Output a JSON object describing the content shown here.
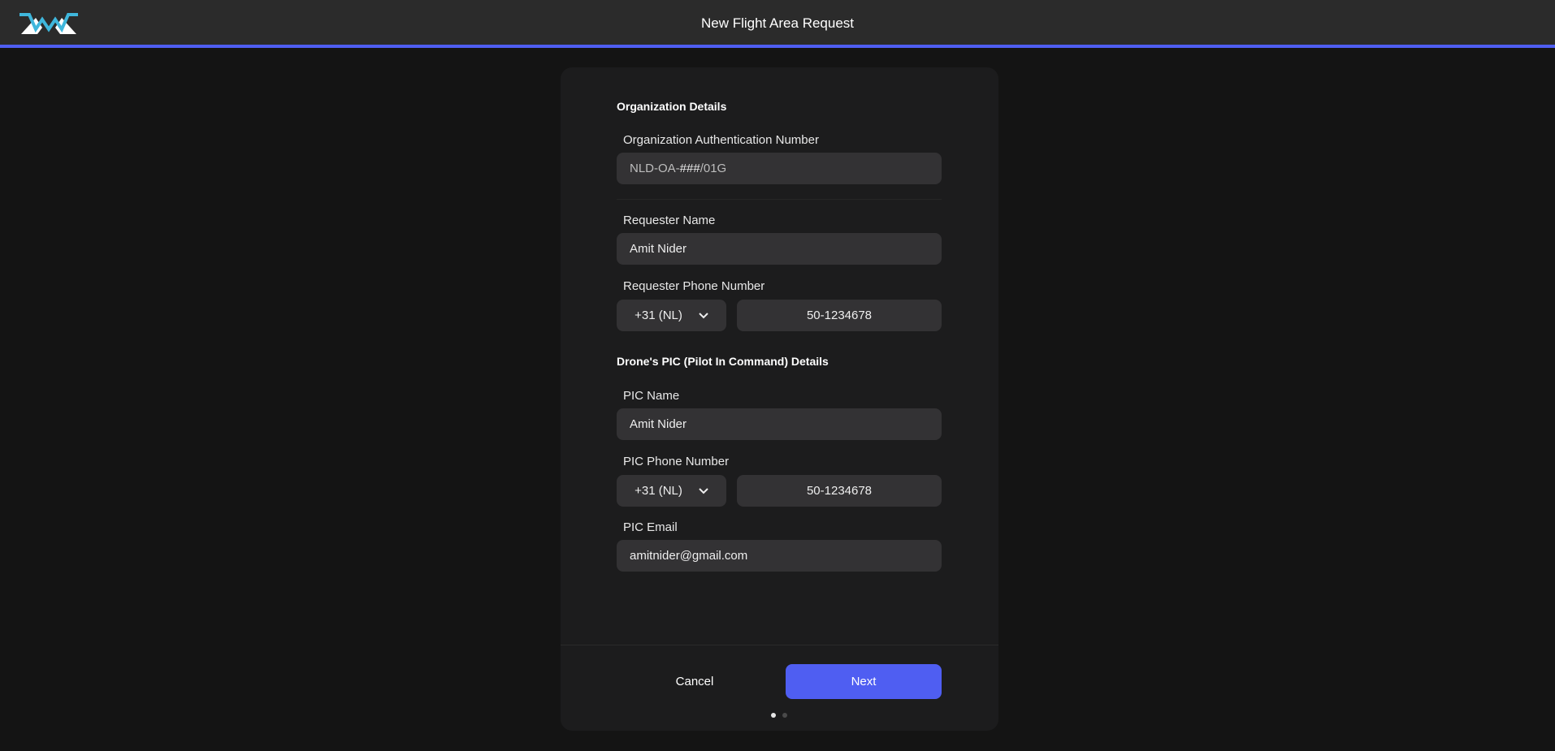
{
  "header": {
    "title": "New Flight Area Request",
    "accent": "#4f5ef2"
  },
  "org": {
    "section_title": "Organization Details",
    "auth_label": "Organization Authentication Number",
    "auth_prefix": "NLD-OA-",
    "auth_mid": "###",
    "auth_suffix": "/01G"
  },
  "requester": {
    "name_label": "Requester Name",
    "name_value": "Amit Nider",
    "phone_label": "Requester Phone Number",
    "country_code": "+31 (NL)",
    "phone_value": "50-1234678"
  },
  "pic": {
    "section_title": "Drone's PIC (Pilot In Command) Details",
    "name_label": "PIC Name",
    "name_value": "Amit Nider",
    "phone_label": "PIC Phone Number",
    "country_code": "+31 (NL)",
    "phone_value": "50-1234678",
    "email_label": "PIC Email",
    "email_value": "amitnider@gmail.com"
  },
  "footer": {
    "cancel_label": "Cancel",
    "next_label": "Next",
    "current_step": 1,
    "total_steps": 2
  }
}
